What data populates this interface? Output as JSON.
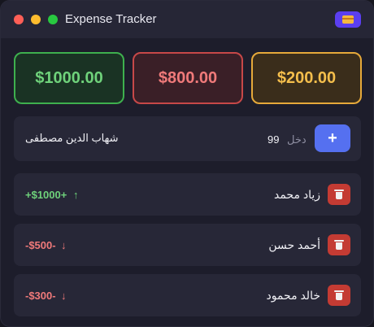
{
  "window": {
    "title": "Expense Tracker",
    "wallet_icon": "credit-card-icon"
  },
  "summary": {
    "income": "$1000.00",
    "expense": "$800.00",
    "balance": "$200.00"
  },
  "form": {
    "name_value": "شهاب الدين مصطفى",
    "amount_value": "99",
    "type_label": "دخل",
    "add_label": "+"
  },
  "transactions": [
    {
      "name": "زياد محمد",
      "amount": "+$1000+",
      "arrow": "↑",
      "kind": "income"
    },
    {
      "name": "أحمد حسن",
      "amount": "-$500-",
      "arrow": "↓",
      "kind": "expense"
    },
    {
      "name": "خالد محمود",
      "amount": "-$300-",
      "arrow": "↓",
      "kind": "expense"
    }
  ],
  "colors": {
    "income": "#6fd27b",
    "expense": "#f07a7a",
    "balance": "#f4be4c",
    "accent": "#5570f0",
    "delete": "#c43b33"
  }
}
